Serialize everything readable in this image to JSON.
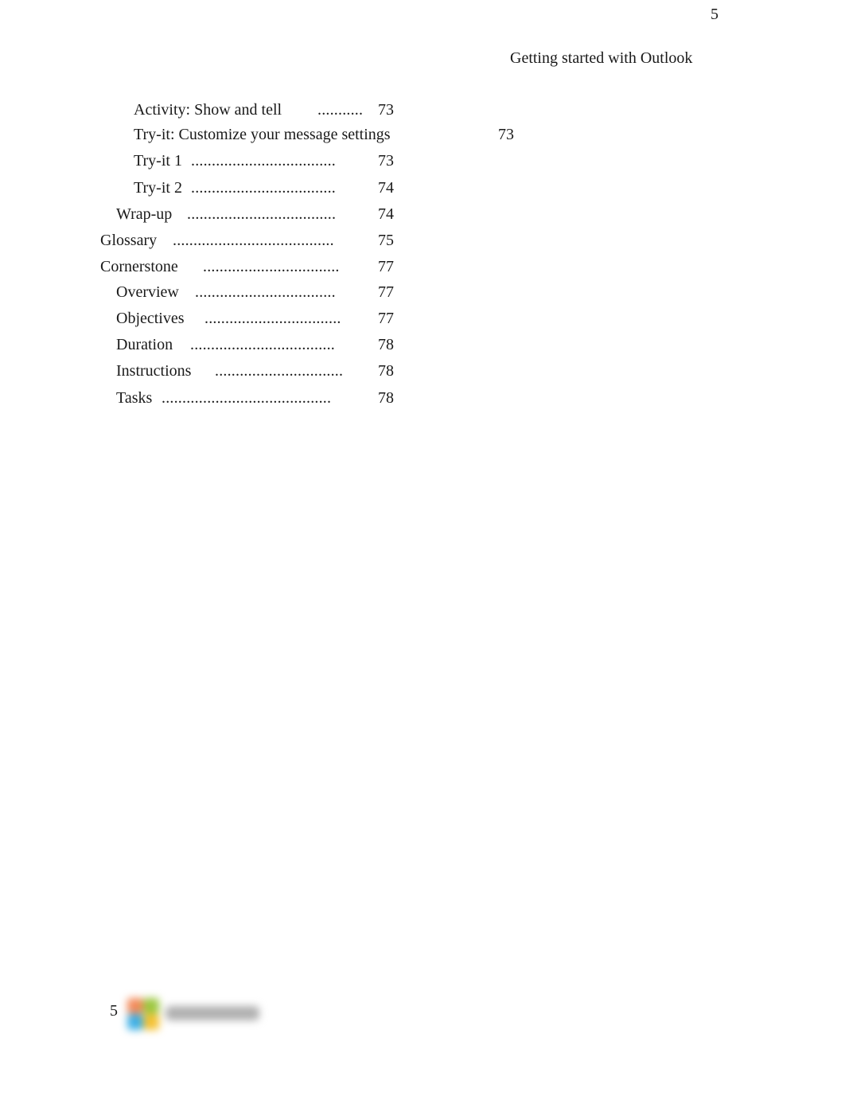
{
  "header": {
    "page_number": "5",
    "running_title": "Getting started with Outlook"
  },
  "toc": [
    {
      "title": "Activity: Show and tell",
      "dots": "...........",
      "page": "73"
    },
    {
      "title": "Try-it: Customize your message settings",
      "dots": "",
      "page": "73"
    },
    {
      "title": "Try-it 1",
      "dots": "...................................",
      "page": "73"
    },
    {
      "title": "Try-it 2",
      "dots": "...................................",
      "page": "74"
    },
    {
      "title": "Wrap-up",
      "dots": "....................................",
      "page": "74"
    },
    {
      "title": "Glossary",
      "dots": ".......................................",
      "page": "75"
    },
    {
      "title": "Cornerstone",
      "dots": ".................................",
      "page": "77"
    },
    {
      "title": "Overview",
      "dots": "..................................",
      "page": "77"
    },
    {
      "title": "Objectives",
      "dots": ".................................",
      "page": "77"
    },
    {
      "title": "Duration",
      "dots": "...................................",
      "page": "78"
    },
    {
      "title": "Instructions",
      "dots": "...............................",
      "page": "78"
    },
    {
      "title": "Tasks",
      "dots": ".........................................",
      "page": "78"
    }
  ],
  "footer": {
    "page_number": "5",
    "logo": "microsoft-logo"
  }
}
